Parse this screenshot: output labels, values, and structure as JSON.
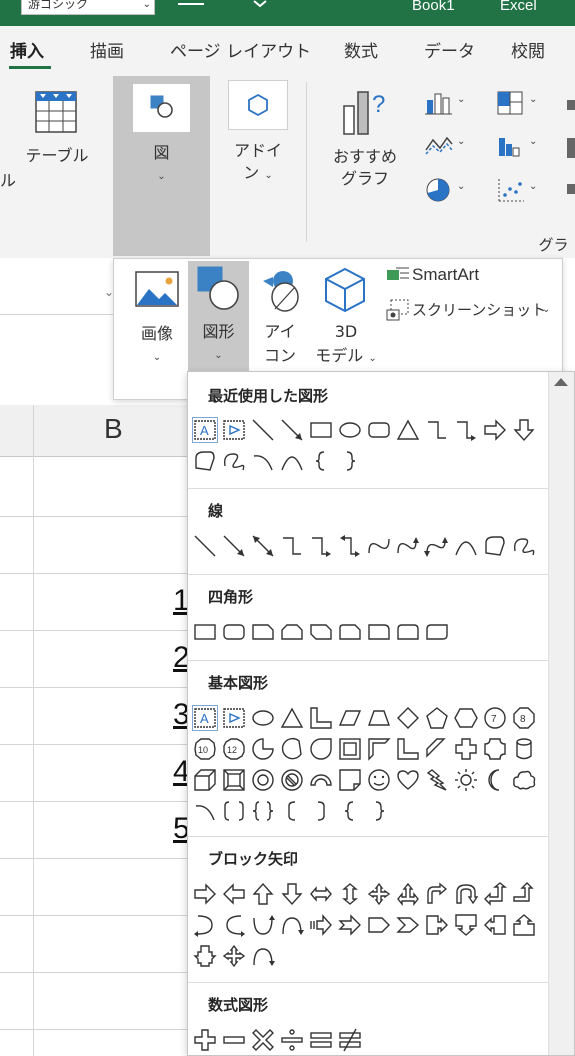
{
  "titlebar": {
    "font_value": "游ゴシック",
    "book": "Book1",
    "app": "Excel"
  },
  "tabs": [
    "挿入",
    "描画",
    "ページ レイアウト",
    "数式",
    "データ",
    "校閲"
  ],
  "ribbon": {
    "table_label": "テーブル",
    "left_cut": "ル",
    "illustrations_label": "図",
    "addins_label_1": "アドイ",
    "addins_label_2": "ン",
    "recommended_label_1": "おすすめ",
    "recommended_label_2": "グラフ",
    "group_chart_label": "グラフ"
  },
  "flyout": {
    "image": "画像",
    "shape": "図形",
    "icon_1": "アイ",
    "icon_2": "コン",
    "model_1": "3D",
    "model_2": "モデル",
    "smartart": "SmartArt",
    "screenshot": "スクリーンショット"
  },
  "sheet": {
    "column_letter": "B",
    "cell_values": [
      "1",
      "2",
      "3",
      "4",
      "5"
    ]
  },
  "gallery": {
    "sections": [
      {
        "title": "最近使用した図形"
      },
      {
        "title": "線"
      },
      {
        "title": "四角形"
      },
      {
        "title": "基本図形"
      },
      {
        "title": "ブロック矢印"
      },
      {
        "title": "数式図形"
      }
    ]
  }
}
